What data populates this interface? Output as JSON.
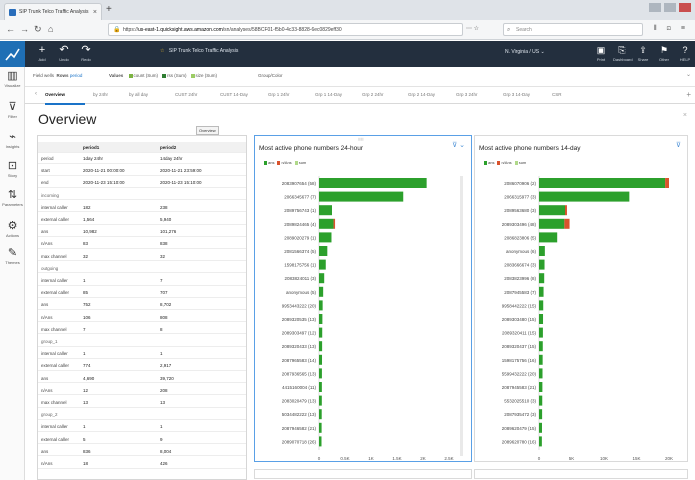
{
  "browser": {
    "tab_title": "SIP Trunk Telco Traffic Analysis",
    "url_host": "us-east-1.quicksight.aws.amazon.com",
    "url_prefix": "https://",
    "url_path": "/sn/analyses/58BCF01-f5b0-4c33-8828-6ec0829eff30",
    "search_placeholder": "Search"
  },
  "app": {
    "analysis_name": "SIP Trunk Telco Traffic Analysis",
    "region": "N. Virginia / US",
    "left_buttons": [
      {
        "icon": "+",
        "label": "Add"
      },
      {
        "icon": "↶",
        "label": "Undo"
      },
      {
        "icon": "↷",
        "label": "Redo"
      }
    ],
    "right_buttons": [
      {
        "icon": "▣",
        "label": "Print"
      },
      {
        "icon": "⎘",
        "label": "Dashboard"
      },
      {
        "icon": "⇪",
        "label": "Share"
      },
      {
        "icon": "⚑",
        "label": "Other"
      },
      {
        "icon": "?",
        "label": "HELP"
      }
    ]
  },
  "rail": [
    {
      "icon": "▥",
      "label": "Visualize"
    },
    {
      "icon": "⊽",
      "label": "Filter"
    },
    {
      "icon": "⌁",
      "label": "Insights"
    },
    {
      "icon": "⊡",
      "label": "Story"
    },
    {
      "icon": "⇅",
      "label": "Parameters"
    },
    {
      "icon": "⚙",
      "label": "Actions"
    },
    {
      "icon": "✎",
      "label": "Themes"
    }
  ],
  "wells": {
    "label": "Field wells",
    "rows_label": "Rows",
    "rows_value": "period",
    "values_label": "Values",
    "values": [
      {
        "name": "count (Sum)",
        "color": "#7cb342"
      },
      {
        "name": "rss (Sum)",
        "color": "#2e7d32"
      },
      {
        "name": "size (Sum)",
        "color": "#9ccc65"
      }
    ],
    "group_label": "Group/Color"
  },
  "sheets": {
    "tabs": [
      "Overview",
      "by 24hr",
      "by all day",
      "CUST 24hr",
      "CUST 14-Day",
      "Grp 1 24hr",
      "Grp 1 14-Day",
      "Grp 2 24hr",
      "Grp 2 14-Day",
      "Grp 3 24hr",
      "Grp 3 14-Day",
      "CSR"
    ]
  },
  "page": {
    "title": "Overview",
    "visual_label": "Overview"
  },
  "table": {
    "headers": [
      "",
      "period1",
      "period2"
    ],
    "rows": [
      {
        "kind": "row",
        "cells": [
          "period",
          "1day 24hr",
          "14day 24hr"
        ]
      },
      {
        "kind": "row",
        "cells": [
          "start",
          "2020-11-21 00:00:00",
          "2020-11-21 23:59:00"
        ]
      },
      {
        "kind": "row",
        "cells": [
          "end",
          "2020-11-23 15:10:00",
          "2020-11-23 15:10:00"
        ]
      },
      {
        "kind": "sect",
        "cells": [
          "incoming",
          "",
          ""
        ]
      },
      {
        "kind": "row",
        "cells": [
          "internal caller",
          "182",
          "238"
        ]
      },
      {
        "kind": "row",
        "cells": [
          "external caller",
          "1,564",
          "5,940"
        ]
      },
      {
        "kind": "row",
        "cells": [
          "ans",
          "10,982",
          "101,276"
        ]
      },
      {
        "kind": "row",
        "cells": [
          "n/Ans",
          "83",
          "838"
        ]
      },
      {
        "kind": "row",
        "cells": [
          "max channel",
          "32",
          "32"
        ]
      },
      {
        "kind": "sect",
        "cells": [
          "outgoing",
          "",
          ""
        ]
      },
      {
        "kind": "row",
        "cells": [
          "internal caller",
          "1",
          "7"
        ]
      },
      {
        "kind": "row",
        "cells": [
          "external caller",
          "85",
          "707"
        ]
      },
      {
        "kind": "row",
        "cells": [
          "ans",
          "752",
          "8,702"
        ]
      },
      {
        "kind": "row",
        "cells": [
          "n/Ans",
          "106",
          "808"
        ]
      },
      {
        "kind": "row",
        "cells": [
          "max channel",
          "7",
          "8"
        ]
      },
      {
        "kind": "sect",
        "cells": [
          "group_1",
          "",
          ""
        ]
      },
      {
        "kind": "row",
        "cells": [
          "internal caller",
          "1",
          "1"
        ]
      },
      {
        "kind": "row",
        "cells": [
          "external caller",
          "774",
          "2,917"
        ]
      },
      {
        "kind": "row",
        "cells": [
          "ans",
          "4,690",
          "39,720"
        ]
      },
      {
        "kind": "row",
        "cells": [
          "n/Ans",
          "12",
          "208"
        ]
      },
      {
        "kind": "row",
        "cells": [
          "max channel",
          "13",
          "13"
        ]
      },
      {
        "kind": "sect",
        "cells": [
          "group_2",
          "",
          ""
        ]
      },
      {
        "kind": "row",
        "cells": [
          "internal caller",
          "1",
          "1"
        ]
      },
      {
        "kind": "row",
        "cells": [
          "external caller",
          "5",
          "9"
        ]
      },
      {
        "kind": "row",
        "cells": [
          "ans",
          "836",
          "8,004"
        ]
      },
      {
        "kind": "row",
        "cells": [
          "n/Ans",
          "18",
          "426"
        ]
      }
    ]
  },
  "chart_data": [
    {
      "type": "bar",
      "orientation": "horizontal",
      "title": "Most active phone numbers 24-hour",
      "legend": [
        "ans",
        "n/Ans",
        "sum"
      ],
      "categories": [
        "2083907654 (58)",
        "2066345677 (7)",
        "2089756743 (1)",
        "2089824465 (4)",
        "2089020279 (1)",
        "2081566374 (5)",
        "1598175756 (1)",
        "2083824011 (3)",
        "anonymous (5)",
        "9953443222 (20)",
        "2089320535 (13)",
        "2089303497 (12)",
        "2089320433 (13)",
        "2087965583 (14)",
        "2087936565 (13)",
        "4415160004 (11)",
        "2083020479 (13)",
        "5034482222 (13)",
        "2087946582 (21)",
        "2089070718 (26)"
      ],
      "series": [
        {
          "name": "ans",
          "values": [
            2070,
            1620,
            250,
            280,
            240,
            160,
            130,
            100,
            80,
            70,
            65,
            62,
            60,
            58,
            56,
            55,
            54,
            52,
            50,
            48
          ]
        },
        {
          "name": "n/Ans",
          "values": [
            0,
            0,
            0,
            20,
            0,
            0,
            0,
            0,
            0,
            0,
            0,
            0,
            0,
            0,
            0,
            0,
            0,
            0,
            0,
            0
          ]
        }
      ],
      "xlim": [
        0,
        2500
      ],
      "xticks": [
        "0",
        "0.5K",
        "1K",
        "1.5K",
        "2K",
        "2.5K"
      ]
    },
    {
      "type": "bar",
      "orientation": "horizontal",
      "title": "Most active phone numbers 14-day",
      "legend": [
        "ans",
        "n/Ans",
        "sum"
      ],
      "categories": [
        "2086070906 (2)",
        "2066315977 (3)",
        "2089563680 (3)",
        "2089303496 (48)",
        "2086823806 (5)",
        "anonymous (6)",
        "2083666674 (3)",
        "2083823996 (8)",
        "2087945583 (7)",
        "9958442222 (15)",
        "2089303480 (15)",
        "2089320411 (15)",
        "2089320437 (15)",
        "1598175756 (16)",
        "5599432222 (20)",
        "2087945583 (21)",
        "5532025510 (3)",
        "2087935472 (3)",
        "2089620479 (15)",
        "2089620780 (16)"
      ],
      "series": [
        {
          "name": "ans",
          "values": [
            19400,
            13900,
            4000,
            3900,
            2800,
            900,
            850,
            800,
            700,
            650,
            620,
            600,
            580,
            560,
            540,
            520,
            500,
            480,
            460,
            440
          ]
        },
        {
          "name": "n/Ans",
          "values": [
            600,
            0,
            300,
            800,
            0,
            0,
            0,
            0,
            0,
            0,
            0,
            0,
            0,
            0,
            0,
            0,
            0,
            0,
            0,
            0
          ]
        }
      ],
      "xlim": [
        0,
        20000
      ],
      "xticks": [
        "0",
        "5K",
        "10K",
        "15K",
        "20K"
      ]
    }
  ],
  "colors": {
    "ans": "#2ca02c",
    "nans": "#d9532c",
    "sum": "#b0d98a",
    "header_bg": "#232f3e",
    "accent": "#1a73c8"
  }
}
